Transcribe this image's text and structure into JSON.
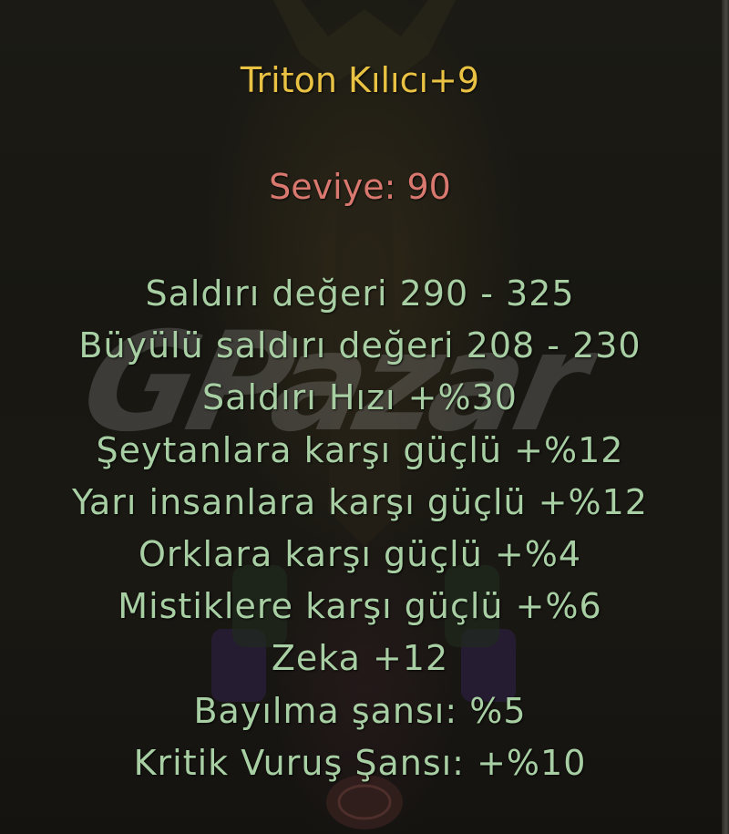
{
  "item": {
    "name": "Triton Kılıcı+9",
    "level_label": "Seviye: 90",
    "stats": [
      "Saldırı değeri 290 - 325",
      "Büyülü saldırı değeri 208 - 230",
      "Saldırı Hızı +%30",
      "Şeytanlara karşı güçlü +%12",
      "Yarı insanlara karşı güçlü +%12",
      "Orklara karşı güçlü +%4",
      "Mistiklere karşı güçlü +%6",
      "Zeka +12",
      "Bayılma şansı: %5",
      "Kritik Vuruş Şansı: +%10"
    ]
  },
  "watermark": {
    "text": "GPazar"
  },
  "colors": {
    "title": "#e9c143",
    "level": "#d9786f",
    "stat": "#a8cfa3",
    "background": "#1a1813"
  }
}
